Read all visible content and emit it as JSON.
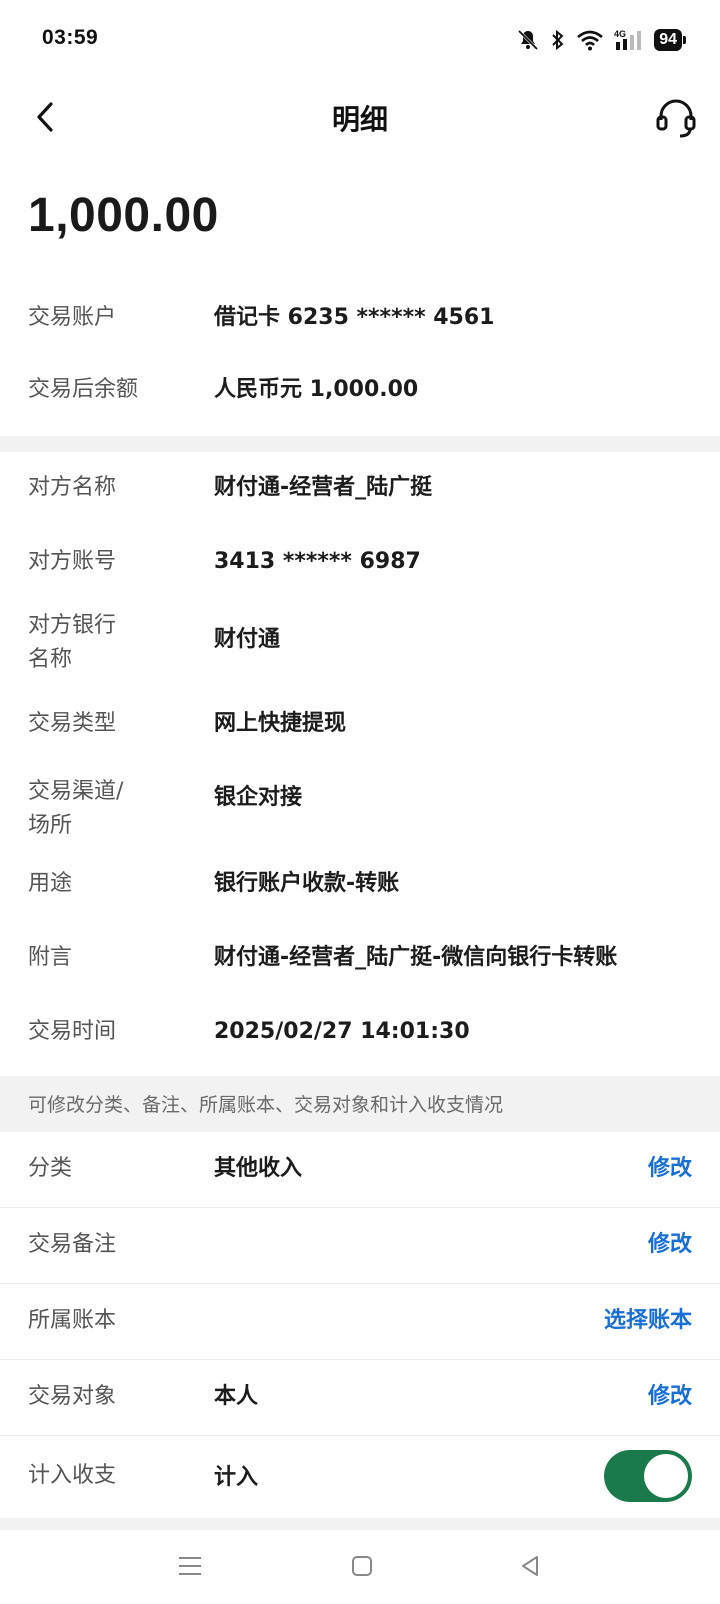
{
  "status_bar": {
    "time": "03:59",
    "icons": [
      "mute-bell-icon",
      "bluetooth-icon",
      "wifi-icon",
      "signal-4g-icon"
    ],
    "network": "4G",
    "battery": "94"
  },
  "header": {
    "title": "明细",
    "back_icon": "chevron-left-icon",
    "service_icon": "headset-icon"
  },
  "amount": "1,000.00",
  "account_section": [
    {
      "label": "交易账户",
      "value": "借记卡 6235 ****** 4561"
    },
    {
      "label": "交易后余额",
      "value": "人民币元 1,000.00"
    }
  ],
  "detail_section": {
    "counterparty_name": {
      "label": "对方名称",
      "value": "财付通-经营者_陆广挺"
    },
    "counterparty_account": {
      "label": "对方账号",
      "value": "3413 ****** 6987"
    },
    "counterparty_bank": {
      "label_line1": "对方银行",
      "label_line2": "名称",
      "value": "财付通"
    },
    "txn_type": {
      "label": "交易类型",
      "value": "网上快捷提现"
    },
    "channel": {
      "label_line1": "交易渠道/",
      "label_line2": "场所",
      "value": "银企对接"
    },
    "purpose": {
      "label": "用途",
      "value": "银行账户收款-转账"
    },
    "remark": {
      "label": "附言",
      "value": "财付通-经营者_陆广挺-微信向银行卡转账"
    },
    "time": {
      "label": "交易时间",
      "value": "2025/02/27 14:01:30"
    }
  },
  "notice": "可修改分类、备注、所属账本、交易对象和计入收支情况",
  "edit_section": {
    "category": {
      "label": "分类",
      "value": "其他收入",
      "action": "修改"
    },
    "note": {
      "label": "交易备注",
      "value": "",
      "action": "修改"
    },
    "ledger": {
      "label": "所属账本",
      "value": "",
      "action": "选择账本"
    },
    "party": {
      "label": "交易对象",
      "value": "本人",
      "action": "修改"
    },
    "include": {
      "label": "计入收支",
      "value": "计入",
      "toggle_on": true
    }
  },
  "colors": {
    "accent_blue": "#1a6fd6",
    "toggle_green": "#1a7a4c"
  },
  "system_nav": [
    "menu-icon",
    "home-square-icon",
    "back-triangle-icon"
  ]
}
